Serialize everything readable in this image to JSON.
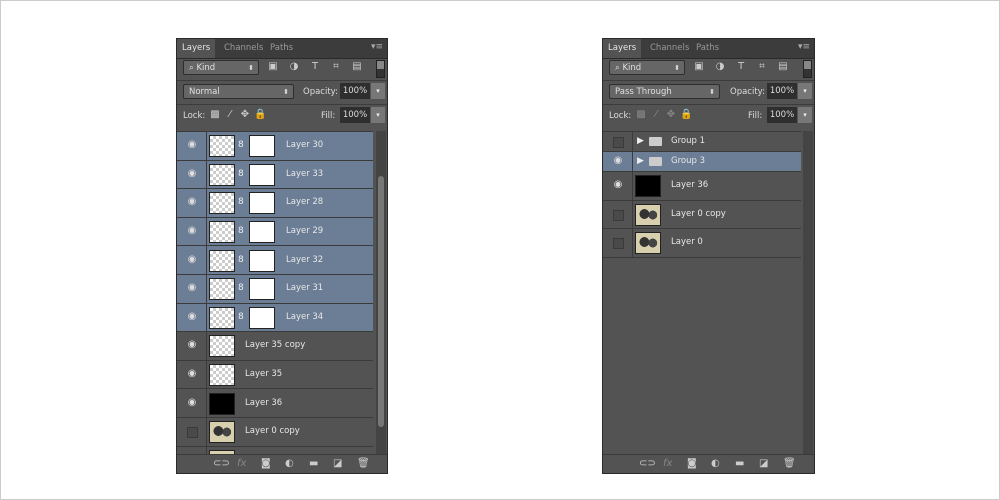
{
  "left_panel": {
    "tabs": [
      "Layers",
      "Channels",
      "Paths"
    ],
    "filter": "Kind",
    "blend_mode": "Normal",
    "opacity_label": "Opacity:",
    "opacity": "100%",
    "lock_label": "Lock:",
    "fill_label": "Fill:",
    "fill": "100%",
    "layers": [
      {
        "name": "Layer 30",
        "visible": true,
        "selected": true,
        "thumb": "checker",
        "mask": true
      },
      {
        "name": "Layer 33",
        "visible": true,
        "selected": true,
        "thumb": "checker",
        "mask": true
      },
      {
        "name": "Layer 28",
        "visible": true,
        "selected": true,
        "thumb": "checker",
        "mask": true
      },
      {
        "name": "Layer 29",
        "visible": true,
        "selected": true,
        "thumb": "checker",
        "mask": true
      },
      {
        "name": "Layer 32",
        "visible": true,
        "selected": true,
        "thumb": "checker",
        "mask": true
      },
      {
        "name": "Layer 31",
        "visible": true,
        "selected": true,
        "thumb": "checker",
        "mask": true
      },
      {
        "name": "Layer 34",
        "visible": true,
        "selected": true,
        "thumb": "checker",
        "mask": true
      },
      {
        "name": "Layer 35 copy",
        "visible": true,
        "selected": false,
        "thumb": "checker",
        "mask": false
      },
      {
        "name": "Layer 35",
        "visible": true,
        "selected": false,
        "thumb": "checker",
        "mask": false
      },
      {
        "name": "Layer 36",
        "visible": true,
        "selected": false,
        "thumb": "black",
        "mask": false
      },
      {
        "name": "Layer 0 copy",
        "visible": false,
        "selected": false,
        "thumb": "photo",
        "mask": false
      },
      {
        "name": "",
        "visible": false,
        "selected": false,
        "thumb": "photo",
        "mask": false
      }
    ]
  },
  "right_panel": {
    "tabs": [
      "Layers",
      "Channels",
      "Paths"
    ],
    "filter": "Kind",
    "blend_mode": "Pass Through",
    "opacity_label": "Opacity:",
    "opacity": "100%",
    "lock_label": "Lock:",
    "fill_label": "Fill:",
    "fill": "100%",
    "layers": [
      {
        "name": "Group 1",
        "visible": false,
        "selected": false,
        "group": true
      },
      {
        "name": "Group 3",
        "visible": true,
        "selected": true,
        "group": true
      },
      {
        "name": "Layer 36",
        "visible": true,
        "selected": false,
        "thumb": "black"
      },
      {
        "name": "Layer 0 copy",
        "visible": false,
        "selected": false,
        "thumb": "photo"
      },
      {
        "name": "Layer 0",
        "visible": false,
        "selected": false,
        "thumb": "photo"
      }
    ]
  },
  "icons": {
    "filter_types": [
      "image-icon",
      "adjustment-icon",
      "type-icon",
      "shape-icon",
      "smart-object-icon"
    ],
    "lock": [
      "lock-transparent-icon",
      "lock-brush-icon",
      "lock-move-icon",
      "lock-all-icon"
    ],
    "footer": [
      "link-icon",
      "fx-icon",
      "mask-icon",
      "adjustment-layer-icon",
      "folder-icon",
      "new-layer-icon",
      "trash-icon"
    ]
  },
  "colors": {
    "panel": "#535353",
    "selected": "#6c7e95",
    "tabbar": "#3c3c3c"
  }
}
